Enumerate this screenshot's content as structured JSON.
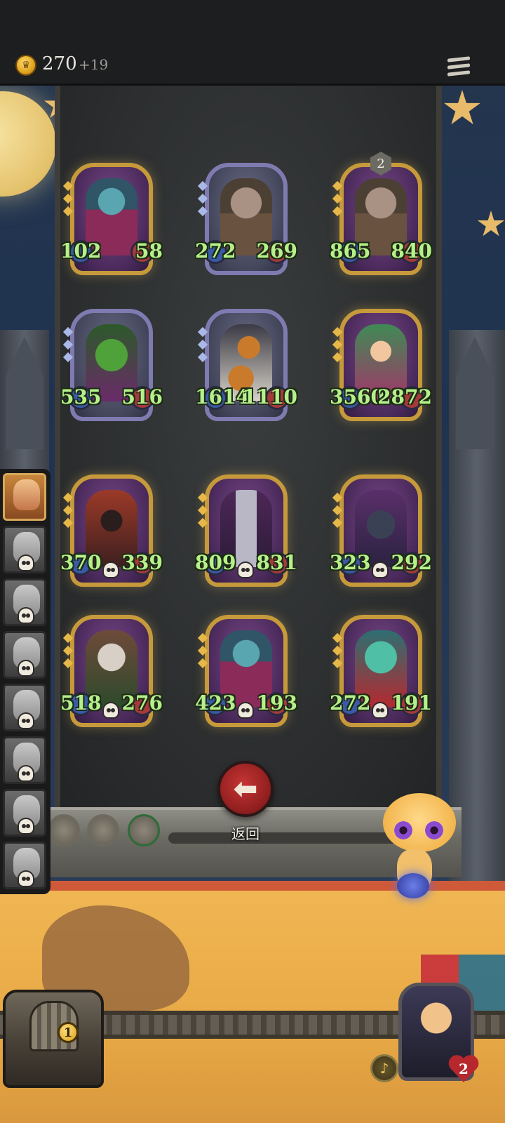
{
  "header": {
    "coins": "270",
    "coin_bonus": "+19",
    "coin_icon": "crown-coin-icon",
    "menu_icon": "menu-icon"
  },
  "cards": [
    {
      "atk": "102",
      "hp": "58",
      "style": "gold",
      "portrait": "elf"
    },
    {
      "atk": "272",
      "hp": "269",
      "style": "silver",
      "portrait": "ogre"
    },
    {
      "atk": "865",
      "hp": "840",
      "style": "gold",
      "portrait": "ogre",
      "tier": "2"
    },
    {
      "atk": "535",
      "hp": "516",
      "style": "silver",
      "portrait": "dryad"
    },
    {
      "atk": "1614",
      "hp": "1110",
      "style": "silver",
      "portrait": "pumpkin"
    },
    {
      "atk": "3560",
      "hp": "2872",
      "style": "gold",
      "portrait": "fairy"
    },
    {
      "atk": "370",
      "hp": "339",
      "style": "gold",
      "portrait": "rogue"
    },
    {
      "atk": "809",
      "hp": "831",
      "style": "gold",
      "portrait": "vial"
    },
    {
      "atk": "323",
      "hp": "292",
      "style": "gold",
      "portrait": "goblin"
    },
    {
      "atk": "518",
      "hp": "276",
      "style": "gold",
      "portrait": "hag"
    },
    {
      "atk": "423",
      "hp": "193",
      "style": "gold",
      "portrait": "elf"
    },
    {
      "atk": "272",
      "hp": "191",
      "style": "gold",
      "portrait": "ghost"
    }
  ],
  "back_button": {
    "label": "返回",
    "icon": "back-arrow-icon"
  },
  "chest": {
    "count": "1"
  },
  "hero": {
    "lives": "2"
  }
}
